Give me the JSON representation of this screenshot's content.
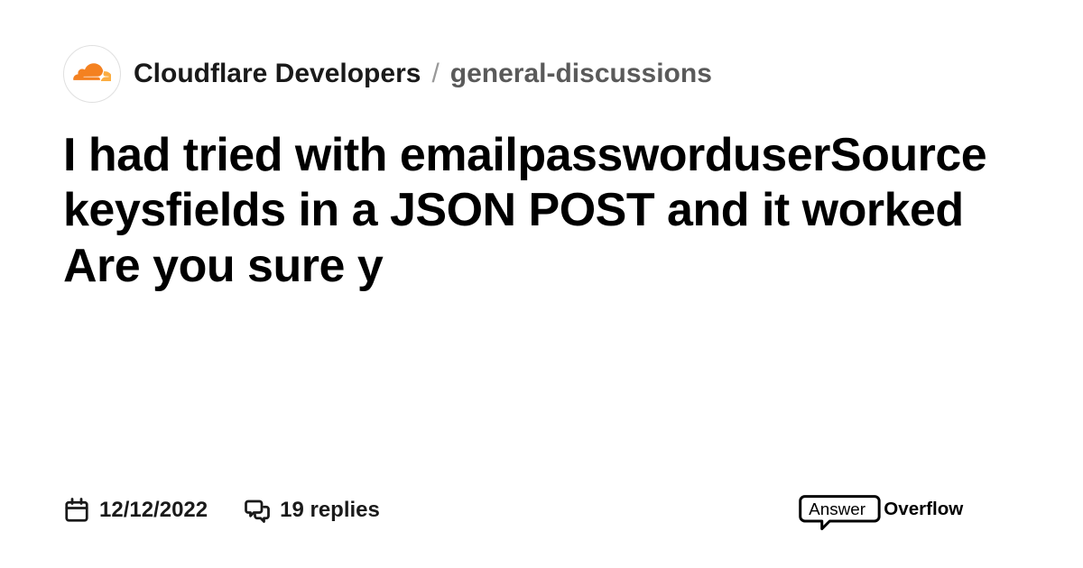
{
  "header": {
    "community": "Cloudflare Developers",
    "separator": "/",
    "channel": "general-discussions",
    "avatar_icon": "cloudflare-logo"
  },
  "post": {
    "title": "I had tried with emailpassworduserSource keysfields in a JSON POST and it worked Are you sure y"
  },
  "meta": {
    "date": "12/12/2022",
    "replies_count": 19,
    "replies_label": "19 replies"
  },
  "branding": {
    "logo_text_light": "Answer",
    "logo_text_bold": "Overflow"
  }
}
